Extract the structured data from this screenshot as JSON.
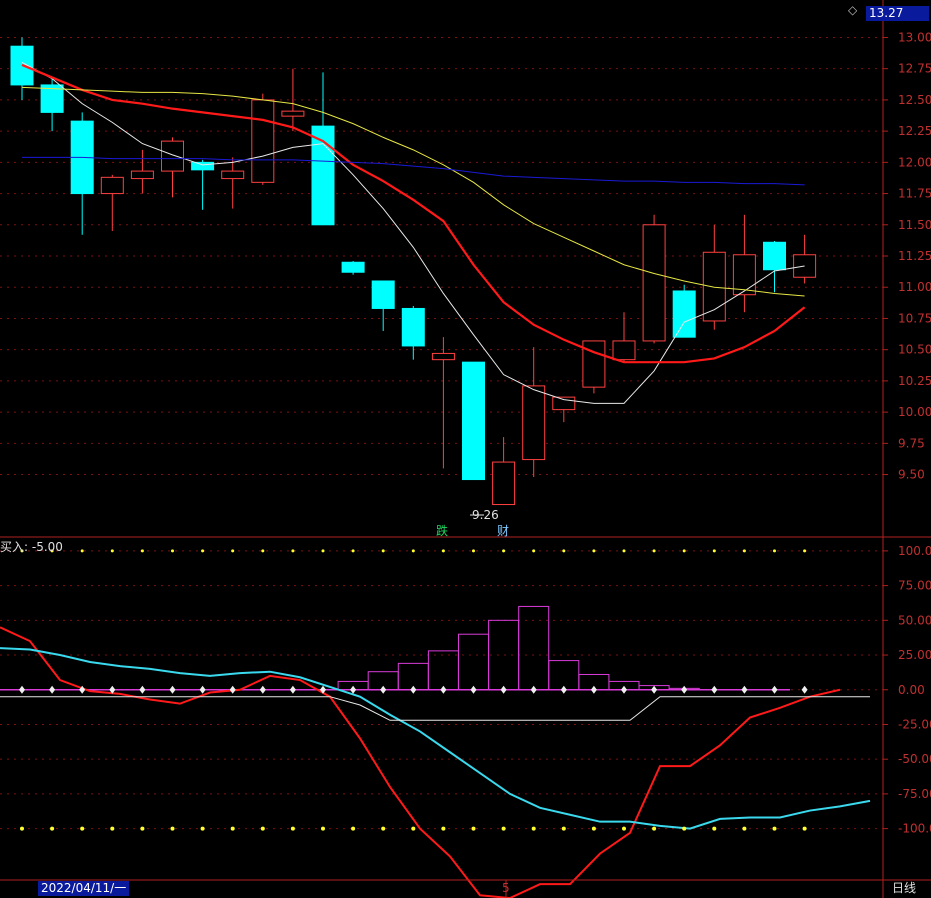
{
  "toolbar": {
    "current_price": "13.27",
    "diamond_icon": "diamond-icon",
    "period_label": "日线"
  },
  "indicator": {
    "label": "买入: -5.00"
  },
  "footer": {
    "date": "2022/04/11/一",
    "cursor_label": "5"
  },
  "markers": {
    "die": "跌",
    "cai": "财",
    "low_label": "9.26"
  },
  "colors": {
    "up": "#ff4040",
    "down": "#00ffff",
    "ma_white": "#e8e8e8",
    "ma_red": "#ff1a1a",
    "ma_yellow": "#e6e645",
    "ma_blue": "#1a1ad6",
    "grid": "#7a1010",
    "hist": "#d93bd9",
    "macd_cyan": "#3ad9ee",
    "dot_yellow": "#ffff30"
  },
  "chart_data": [
    {
      "type": "candlestick",
      "title": "",
      "ylim": [
        9.0,
        13.3
      ],
      "y_ticks": [
        "13.00",
        "12.75",
        "12.50",
        "12.25",
        "12.00",
        "11.75",
        "11.50",
        "11.25",
        "11.00",
        "10.75",
        "10.50",
        "10.25",
        "10.00",
        "9.75",
        "9.50"
      ],
      "candles": [
        {
          "o": 12.93,
          "h": 13.0,
          "l": 12.5,
          "c": 12.62
        },
        {
          "o": 12.62,
          "h": 12.68,
          "l": 12.25,
          "c": 12.4
        },
        {
          "o": 12.33,
          "h": 12.4,
          "l": 11.42,
          "c": 11.75
        },
        {
          "o": 11.75,
          "h": 11.9,
          "l": 11.45,
          "c": 11.88
        },
        {
          "o": 11.87,
          "h": 12.1,
          "l": 11.75,
          "c": 11.93
        },
        {
          "o": 11.93,
          "h": 12.2,
          "l": 11.72,
          "c": 12.17
        },
        {
          "o": 12.0,
          "h": 12.02,
          "l": 11.62,
          "c": 11.94
        },
        {
          "o": 11.87,
          "h": 12.04,
          "l": 11.63,
          "c": 11.93
        },
        {
          "o": 11.84,
          "h": 12.55,
          "l": 11.82,
          "c": 12.5
        },
        {
          "o": 12.37,
          "h": 12.75,
          "l": 12.25,
          "c": 12.41
        },
        {
          "o": 12.29,
          "h": 12.72,
          "l": 11.5,
          "c": 11.5
        },
        {
          "o": 11.2,
          "h": 11.21,
          "l": 11.1,
          "c": 11.12
        },
        {
          "o": 11.05,
          "h": 11.05,
          "l": 10.65,
          "c": 10.83
        },
        {
          "o": 10.83,
          "h": 10.85,
          "l": 10.42,
          "c": 10.53
        },
        {
          "o": 10.42,
          "h": 10.6,
          "l": 9.55,
          "c": 10.47
        },
        {
          "o": 10.4,
          "h": 10.4,
          "l": 9.46,
          "c": 9.46
        },
        {
          "o": 9.26,
          "h": 9.8,
          "l": 9.26,
          "c": 9.6
        },
        {
          "o": 9.62,
          "h": 10.52,
          "l": 9.48,
          "c": 10.21
        },
        {
          "o": 10.02,
          "h": 10.12,
          "l": 9.92,
          "c": 10.12
        },
        {
          "o": 10.2,
          "h": 10.57,
          "l": 10.15,
          "c": 10.57
        },
        {
          "o": 10.42,
          "h": 10.8,
          "l": 10.4,
          "c": 10.57
        },
        {
          "o": 10.57,
          "h": 11.58,
          "l": 10.55,
          "c": 11.5
        },
        {
          "o": 10.97,
          "h": 11.02,
          "l": 10.6,
          "c": 10.6
        },
        {
          "o": 10.73,
          "h": 11.5,
          "l": 10.66,
          "c": 11.28
        },
        {
          "o": 10.94,
          "h": 11.58,
          "l": 10.8,
          "c": 11.26
        },
        {
          "o": 11.36,
          "h": 11.37,
          "l": 10.96,
          "c": 11.14
        },
        {
          "o": 11.08,
          "h": 11.42,
          "l": 11.03,
          "c": 11.26
        }
      ],
      "series": [
        {
          "color_key": "ma_white",
          "values": [
            12.8,
            12.67,
            12.47,
            12.32,
            12.15,
            12.06,
            11.98,
            12.0,
            12.05,
            12.12,
            12.15,
            11.9,
            11.63,
            11.32,
            10.95,
            10.62,
            10.3,
            10.18,
            10.1,
            10.07,
            10.07,
            10.33,
            10.72,
            10.82,
            10.97,
            11.13,
            11.17
          ]
        },
        {
          "color_key": "ma_red",
          "values": [
            12.78,
            12.68,
            12.58,
            12.5,
            12.47,
            12.43,
            12.4,
            12.37,
            12.34,
            12.28,
            12.17,
            11.98,
            11.85,
            11.7,
            11.53,
            11.18,
            10.88,
            10.7,
            10.58,
            10.48,
            10.4,
            10.4,
            10.4,
            10.43,
            10.52,
            10.65,
            10.84
          ]
        },
        {
          "color_key": "ma_yellow",
          "values": [
            12.6,
            12.59,
            12.58,
            12.57,
            12.56,
            12.56,
            12.55,
            12.53,
            12.5,
            12.47,
            12.4,
            12.31,
            12.2,
            12.1,
            11.98,
            11.84,
            11.66,
            11.51,
            11.4,
            11.29,
            11.18,
            11.11,
            11.05,
            11.0,
            10.98,
            10.95,
            10.93
          ]
        },
        {
          "color_key": "ma_blue",
          "values": [
            12.04,
            12.04,
            12.04,
            12.03,
            12.03,
            12.03,
            12.03,
            12.02,
            12.02,
            12.02,
            12.01,
            12.0,
            11.99,
            11.97,
            11.95,
            11.92,
            11.89,
            11.88,
            11.87,
            11.86,
            11.85,
            11.85,
            11.84,
            11.84,
            11.83,
            11.83,
            11.82
          ]
        }
      ]
    },
    {
      "type": "line",
      "title": "",
      "ylim": [
        -137,
        110
      ],
      "y_ticks": [
        "100.00",
        "75.00",
        "50.00",
        "25.00",
        "0.00",
        "-25.00",
        "-50.00",
        "-75.00",
        "-100.00"
      ],
      "histogram": [
        0,
        0,
        0,
        0,
        0,
        0,
        0,
        0,
        0,
        0,
        0,
        6,
        13,
        19,
        28,
        40,
        50,
        60,
        21,
        11,
        6,
        3,
        1,
        0,
        0,
        0,
        0
      ],
      "series": [
        {
          "color_key": "ma_red",
          "values": [
            45,
            35,
            7,
            -1,
            -3,
            -7,
            -10,
            -2,
            0,
            10,
            7,
            -5,
            -35,
            -70,
            -100,
            -120,
            -148,
            -150,
            -140,
            -140,
            -118,
            -103,
            -55,
            -55,
            -40,
            -20,
            -13,
            -5,
            0
          ]
        },
        {
          "color_key": "macd_cyan",
          "values": [
            30,
            29,
            25,
            20,
            17,
            15,
            12,
            10,
            12,
            13,
            9,
            2,
            -5,
            -18,
            -30,
            -45,
            -60,
            -75,
            -85,
            -90,
            -95,
            -95,
            -98,
            -100,
            -93,
            -92,
            -92,
            -87,
            -84,
            -80
          ]
        },
        {
          "color_key": "ma_white",
          "values": [
            -5,
            -5,
            -5,
            -5,
            -5,
            -5,
            -5,
            -5,
            -5,
            -5,
            -5,
            -5,
            -11,
            -22,
            -22,
            -22,
            -22,
            -22,
            -22,
            -22,
            -22,
            -22,
            -5,
            -5,
            -5,
            -5,
            -5,
            -5,
            -5,
            -5
          ]
        }
      ]
    }
  ]
}
